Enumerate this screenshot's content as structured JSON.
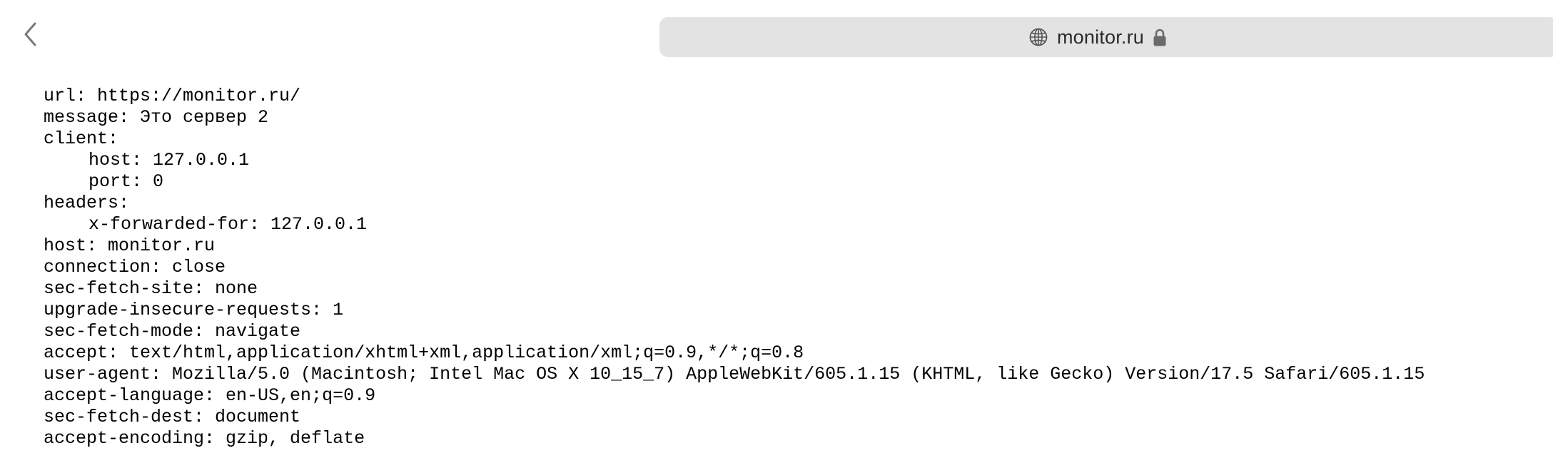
{
  "toolbar": {
    "back_icon": "chevron-left-icon",
    "address": {
      "globe_icon": "globe-icon",
      "url": "monitor.ru",
      "lock_icon": "lock-icon"
    }
  },
  "response": {
    "url": "url: https://monitor.ru/",
    "message": "message: Это сервер 2",
    "client_label": "client:",
    "client_host": "host: 127.0.0.1",
    "client_port": "port: 0",
    "headers_label": "headers:",
    "x_forwarded_for": "x-forwarded-for: 127.0.0.1",
    "host": "host: monitor.ru",
    "connection": "connection: close",
    "sec_fetch_site": "sec-fetch-site: none",
    "upgrade_insecure_requests": "upgrade-insecure-requests: 1",
    "sec_fetch_mode": "sec-fetch-mode: navigate",
    "accept": "accept: text/html,application/xhtml+xml,application/xml;q=0.9,*/*;q=0.8",
    "user_agent": "user-agent: Mozilla/5.0 (Macintosh; Intel Mac OS X 10_15_7) AppleWebKit/605.1.15 (KHTML, like Gecko) Version/17.5 Safari/605.1.15",
    "accept_language": "accept-language: en-US,en;q=0.9",
    "sec_fetch_dest": "sec-fetch-dest: document",
    "accept_encoding": "accept-encoding: gzip, deflate"
  }
}
